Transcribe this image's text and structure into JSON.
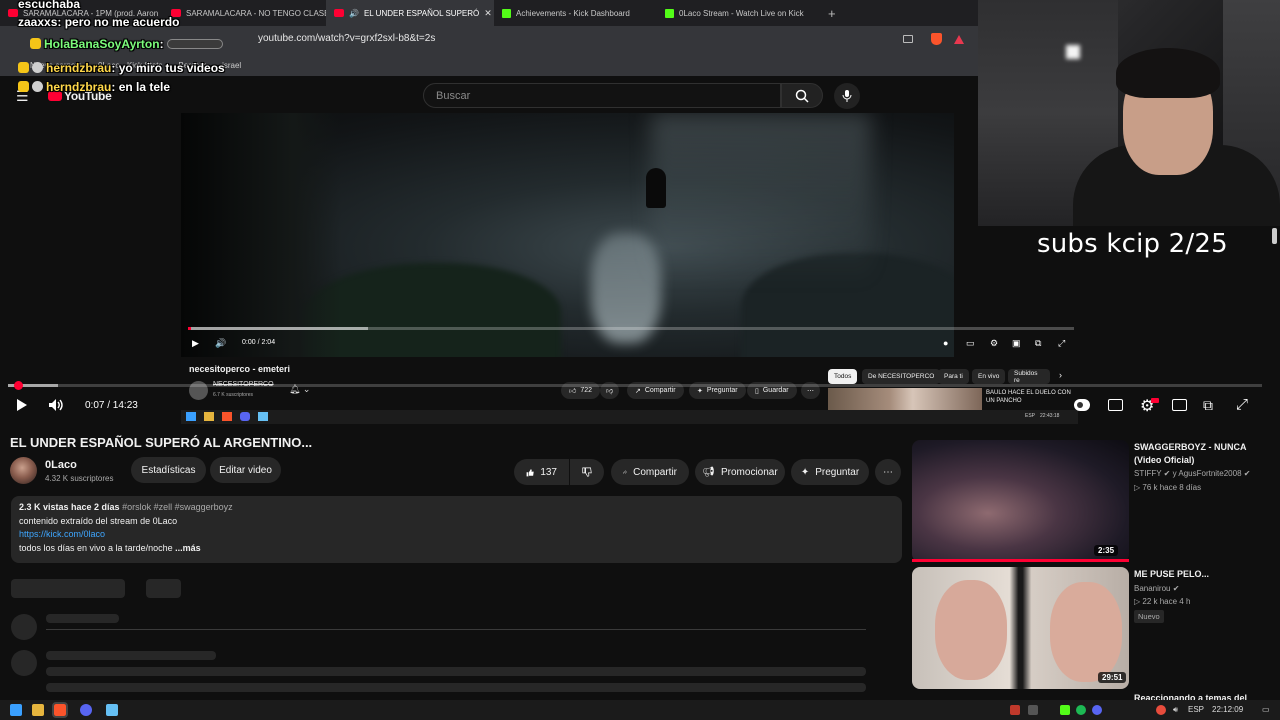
{
  "browser": {
    "tabs": [
      {
        "label": "SARAMALACARA - 1PM (prod. Aaron",
        "icon": "youtube-icon"
      },
      {
        "label": "SARAMALACARA - NO TENGO CLASE",
        "icon": "youtube-icon"
      },
      {
        "label": "EL UNDER ESPAÑOL SUPERÓ",
        "icon": "youtube-icon"
      },
      {
        "label": "Achievements - Kick Dashboard",
        "icon": "kick-icon"
      },
      {
        "label": "0Laco Stream - Watch Live on Kick",
        "icon": "kick-icon"
      }
    ],
    "url": "youtube.com/watch?v=grxf2sxl-b8&t=2s",
    "bookmarks": [
      "Nueva carpeta",
      "0Laco - Kick Stats",
      "Berserk",
      "israel"
    ]
  },
  "chat_overlay": [
    {
      "user": "",
      "text": "escuchaba"
    },
    {
      "user": "zaaxxs",
      "text": "pero no me acuerdo"
    },
    {
      "user": "HolaBanaSoyAyrton",
      "text": ""
    },
    {
      "user": "herndzbrau",
      "text": "yo miro tus videos"
    },
    {
      "user": "herndzbrau",
      "text": "en la tele"
    }
  ],
  "inner_youtube": {
    "logo": "YouTube",
    "search_placeholder": "Buscar",
    "time": "0:00 / 2:04",
    "title": "necesitoperco - emeteri",
    "channel": "NECESITOPERCO",
    "subs": "6.7 K suscriptores",
    "likes": "722",
    "share": "Compartir",
    "ask": "Preguntar",
    "save": "Guardar",
    "chips": [
      "Todos",
      "De NECESITOPERCO",
      "Para ti",
      "En vivo",
      "Subidos re"
    ],
    "rec_title": "BAULO HACE EL DUELO CON UN PANCHO",
    "clock": "22:43:18",
    "lang": "ESP",
    "progress_played": 0.003,
    "progress_buffered": 0.2
  },
  "overlay_text": "subs kcip 2/25",
  "player": {
    "time": "0:07 / 14:23",
    "progress_played": 0.008,
    "progress_buffered": 0.04
  },
  "video": {
    "title": "EL UNDER ESPAÑOL SUPERÓ AL ARGENTINO...",
    "channel": "0Laco",
    "subs": "4.32 K suscriptores",
    "stats_btn": "Estadísticas",
    "edit_btn": "Editar video",
    "likes": "137",
    "share": "Compartir",
    "promote": "Promocionar",
    "ask": "Preguntar",
    "description": {
      "meta": "2.3 K vistas  hace 2 días",
      "tags": "#orslok #zell #swaggerboyz",
      "line1": "contenido extraído del stream de 0Laco",
      "link": "https://kick.com/0laco",
      "line3": "todos los días en vivo a la tarde/noche",
      "more": "...más"
    }
  },
  "recommendations": [
    {
      "title": "SWAGGERBOYZ - NUNCA (Video Oficial)",
      "channel": "STIFFY",
      "collab": "y AgusFortnite2008",
      "meta": "76 k   hace 8 días",
      "duration": "2:35"
    },
    {
      "title": "ME PUSE PELO...",
      "channel": "Bananirou",
      "meta": "22 k   hace 4 h",
      "badge": "Nuevo",
      "duration": "29:51"
    },
    {
      "title": "Reaccionando a temas del"
    }
  ],
  "taskbar": {
    "lang": "ESP",
    "clock": "22:12:09"
  },
  "colors": {
    "accent": "#ff0033",
    "link": "#3ea6ff",
    "chat_name": "#7cfc7c",
    "kick": "#53fc18"
  }
}
